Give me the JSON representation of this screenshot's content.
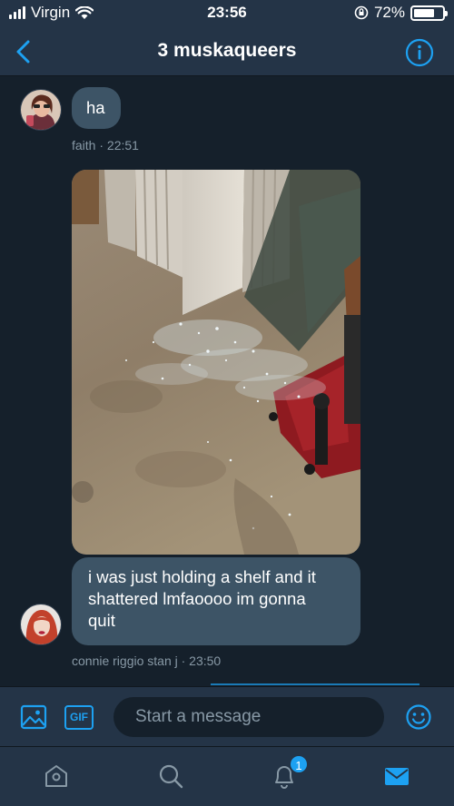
{
  "status_bar": {
    "carrier": "Virgin",
    "time": "23:56",
    "battery": "72%",
    "battery_level": 0.72
  },
  "header": {
    "title": "3 muskaqueers"
  },
  "messages": [
    {
      "sender": "faith",
      "text": "ha",
      "meta": "faith · 22:51"
    },
    {
      "sender": "connie riggio stan j",
      "text": "i was just holding a shelf and it shattered lmfaoooo im gonna quit",
      "line1": "i was just holding a shelf and it",
      "line2": "shattered lmfaoooo im gonna",
      "line3": "quit",
      "meta": "connie riggio stan j · 23:50"
    }
  ],
  "composer": {
    "gif_label": "GIF",
    "placeholder": "Start a message"
  },
  "tab_bar": {
    "notifications_badge": "1"
  },
  "colors": {
    "background": "#15202b",
    "bar": "#243447",
    "bubble": "#3d5466",
    "accent": "#1da1f2",
    "meta_text": "#8899a6"
  }
}
